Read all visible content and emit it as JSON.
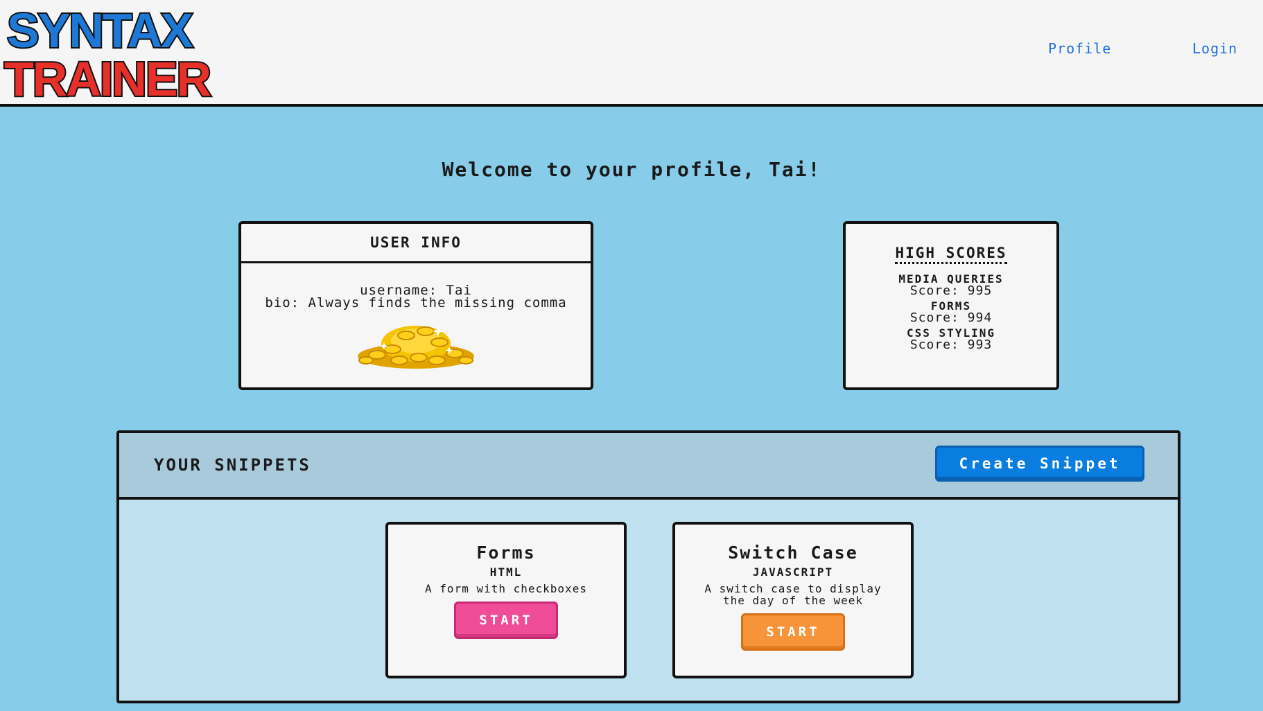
{
  "header": {
    "logo_line1": "SYNTAX",
    "logo_line2": "TRAINER",
    "nav": [
      {
        "label": "Profile"
      },
      {
        "label": "Login"
      }
    ]
  },
  "welcome": "Welcome to your profile, Tai!",
  "user_info": {
    "title": "USER INFO",
    "username": "username: Tai",
    "bio": "bio: Always finds the missing comma",
    "image_icon": "gold-coins-icon"
  },
  "high_scores": {
    "title": "HIGH SCORES",
    "items": [
      {
        "name": "MEDIA QUERIES",
        "score": "Score: 995"
      },
      {
        "name": "FORMS",
        "score": "Score: 994"
      },
      {
        "name": "CSS STYLING",
        "score": "Score: 993"
      }
    ]
  },
  "snippets": {
    "title": "YOUR SNIPPETS",
    "create_label": "Create Snippet",
    "cards": [
      {
        "title": "Forms",
        "language": "HTML",
        "description": "A form with checkboxes",
        "start_label": "START",
        "accent": "#ef4d97"
      },
      {
        "title": "Switch Case",
        "language": "JAVASCRIPT",
        "description": "A switch case to display the day of the week",
        "start_label": "START",
        "accent": "#f7943a"
      }
    ]
  },
  "colors": {
    "page_bg": "#87cdea",
    "header_bg": "#f5f5f5",
    "link": "#1e6fd9",
    "create_button": "#0a7ee0"
  }
}
